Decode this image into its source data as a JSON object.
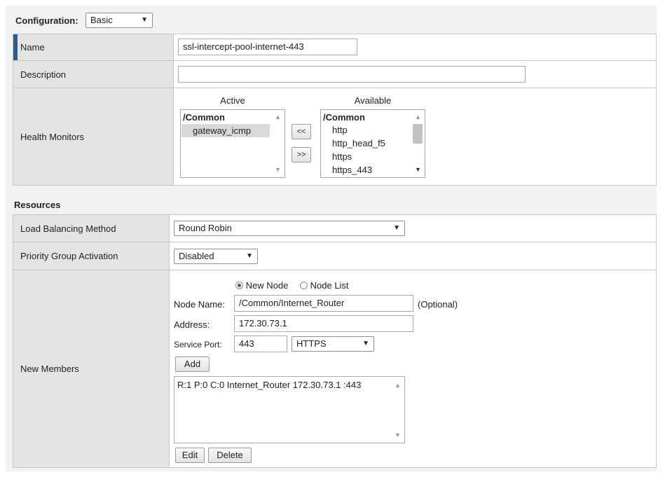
{
  "configuration": {
    "label": "Configuration:",
    "value": "Basic"
  },
  "name_row": {
    "label": "Name",
    "value": "ssl-intercept-pool-internet-443"
  },
  "description_row": {
    "label": "Description",
    "value": ""
  },
  "health_monitors": {
    "label": "Health Monitors",
    "active_header": "Active",
    "available_header": "Available",
    "active_list": [
      "/Common",
      "gateway_icmp"
    ],
    "available_list": [
      "/Common",
      "http",
      "http_head_f5",
      "https",
      "https_443"
    ],
    "move_left_label": "<<",
    "move_right_label": ">>"
  },
  "resources": {
    "title": "Resources",
    "load_balancing": {
      "label": "Load Balancing Method",
      "value": "Round Robin"
    },
    "priority_group": {
      "label": "Priority Group Activation",
      "value": "Disabled"
    }
  },
  "new_members": {
    "label": "New Members",
    "radio_new_node": "New Node",
    "radio_node_list": "Node List",
    "node_name_label": "Node Name:",
    "node_name_value": "/Common/Internet_Router",
    "optional_label": "(Optional)",
    "address_label": "Address:",
    "address_value": "172.30.73.1",
    "service_port_label": "Service Port:",
    "service_port_value": "443",
    "service_select_value": "HTTPS",
    "add_label": "Add",
    "members": [
      "R:1 P:0 C:0 Internet_Router 172.30.73.1 :443"
    ],
    "edit_label": "Edit",
    "delete_label": "Delete"
  },
  "colors": {
    "accent": "#2e5b8a",
    "panel_bg": "#f2f2f2",
    "label_bg": "#e4e4e4"
  }
}
